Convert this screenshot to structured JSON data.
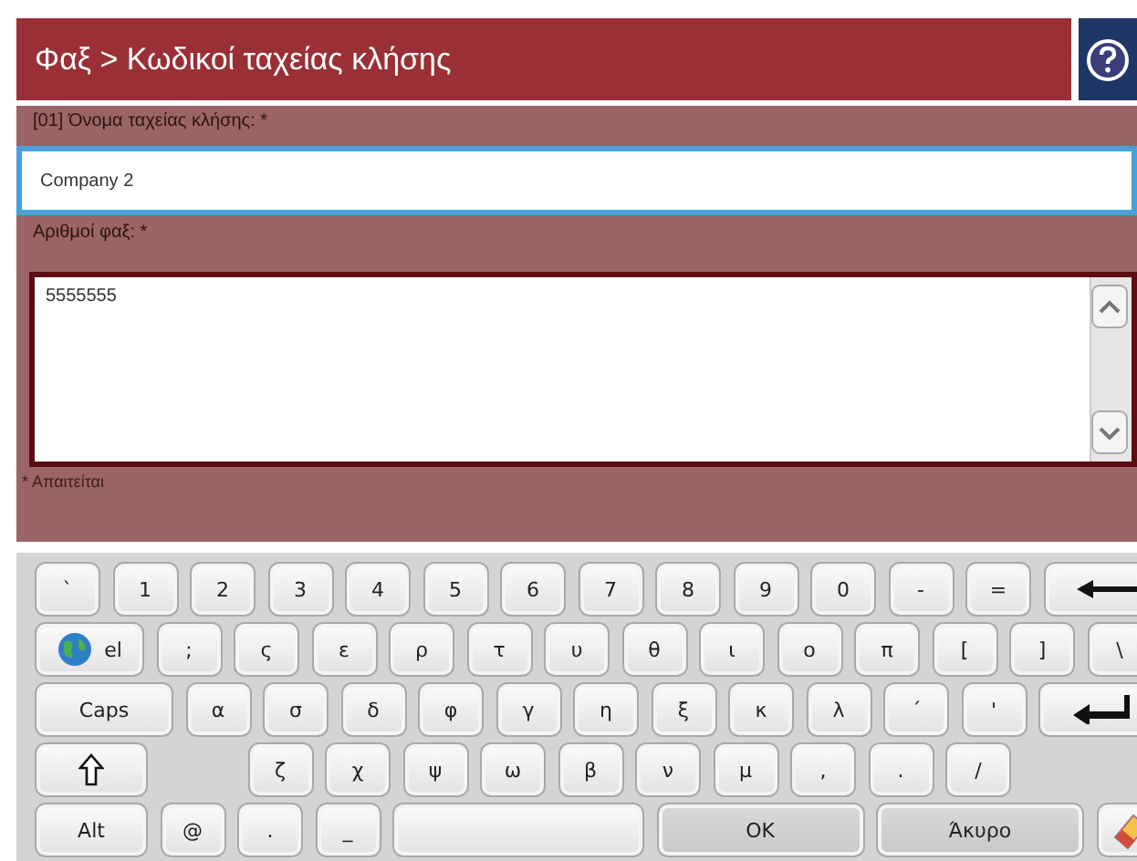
{
  "header": {
    "title": "Φαξ > Κωδικοί ταχείας κλήσης"
  },
  "name_field": {
    "label": "[01] Όνομα ταχείας κλήσης: *",
    "value": "Company 2",
    "focused": true
  },
  "numbers_field": {
    "label": "Αριθμοί φαξ: *",
    "value": "5555555"
  },
  "required_note": "* Απαιτείται",
  "keyboard": {
    "rows": [
      {
        "keys": [
          {
            "kind": "key",
            "label": "`"
          },
          {
            "kind": "key",
            "label": "1"
          },
          {
            "kind": "key",
            "label": "2"
          },
          {
            "kind": "key",
            "label": "3"
          },
          {
            "kind": "key",
            "label": "4"
          },
          {
            "kind": "key",
            "label": "5"
          },
          {
            "kind": "key",
            "label": "6"
          },
          {
            "kind": "key",
            "label": "7"
          },
          {
            "kind": "key",
            "label": "8"
          },
          {
            "kind": "key",
            "label": "9"
          },
          {
            "kind": "key",
            "label": "0"
          },
          {
            "kind": "key",
            "label": "-"
          },
          {
            "kind": "key",
            "label": "="
          },
          {
            "kind": "backspace"
          }
        ]
      },
      {
        "keys": [
          {
            "kind": "lang",
            "label": "el"
          },
          {
            "kind": "key",
            "label": ";"
          },
          {
            "kind": "key",
            "label": "ς"
          },
          {
            "kind": "key",
            "label": "ε"
          },
          {
            "kind": "key",
            "label": "ρ"
          },
          {
            "kind": "key",
            "label": "τ"
          },
          {
            "kind": "key",
            "label": "υ"
          },
          {
            "kind": "key",
            "label": "θ"
          },
          {
            "kind": "key",
            "label": "ι"
          },
          {
            "kind": "key",
            "label": "ο"
          },
          {
            "kind": "key",
            "label": "π"
          },
          {
            "kind": "key",
            "label": "["
          },
          {
            "kind": "key",
            "label": "]"
          },
          {
            "kind": "key",
            "label": "\\"
          }
        ]
      },
      {
        "keys": [
          {
            "kind": "caps",
            "label": "Caps"
          },
          {
            "kind": "key",
            "label": "α"
          },
          {
            "kind": "key",
            "label": "σ"
          },
          {
            "kind": "key",
            "label": "δ"
          },
          {
            "kind": "key",
            "label": "φ"
          },
          {
            "kind": "key",
            "label": "γ"
          },
          {
            "kind": "key",
            "label": "η"
          },
          {
            "kind": "key",
            "label": "ξ"
          },
          {
            "kind": "key",
            "label": "κ"
          },
          {
            "kind": "key",
            "label": "λ"
          },
          {
            "kind": "key",
            "label": "΄"
          },
          {
            "kind": "key",
            "label": "'"
          },
          {
            "kind": "enter"
          }
        ]
      },
      {
        "keys": [
          {
            "kind": "shift"
          },
          {
            "kind": "key",
            "label": "ζ"
          },
          {
            "kind": "key",
            "label": "χ"
          },
          {
            "kind": "key",
            "label": "ψ"
          },
          {
            "kind": "key",
            "label": "ω"
          },
          {
            "kind": "key",
            "label": "β"
          },
          {
            "kind": "key",
            "label": "ν"
          },
          {
            "kind": "key",
            "label": "μ"
          },
          {
            "kind": "key",
            "label": ","
          },
          {
            "kind": "key",
            "label": "."
          },
          {
            "kind": "key",
            "label": "/"
          }
        ]
      },
      {
        "keys": [
          {
            "kind": "wide",
            "label": "Alt"
          },
          {
            "kind": "key",
            "label": "@"
          },
          {
            "kind": "key",
            "label": "."
          },
          {
            "kind": "key",
            "label": "_"
          },
          {
            "kind": "space"
          },
          {
            "kind": "action",
            "label": "OK"
          },
          {
            "kind": "action",
            "label": "Άκυρο"
          },
          {
            "kind": "eraser"
          }
        ]
      }
    ]
  }
}
